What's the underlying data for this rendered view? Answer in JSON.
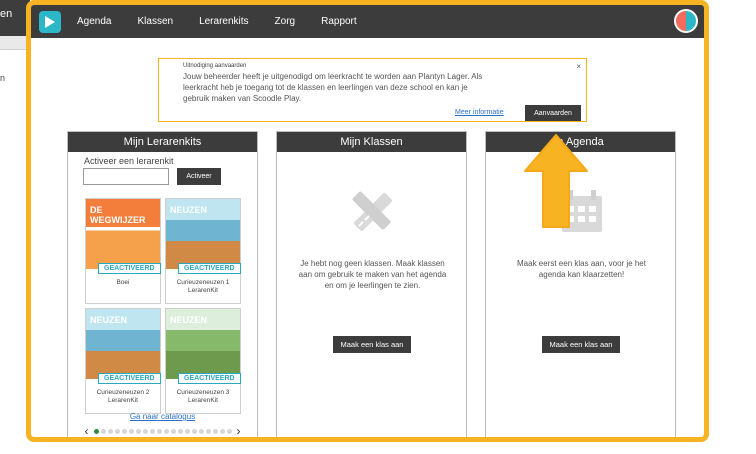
{
  "background": {
    "nav_fragment": "en",
    "sub_fragment": "n"
  },
  "nav": {
    "items": [
      "Agenda",
      "Klassen",
      "Lerarenkits",
      "Zorg",
      "Rapport"
    ]
  },
  "invite": {
    "title": "Uitnodiging aanvaarden",
    "text": "Jouw beheerder heeft je uitgenodigd om leerkracht te worden aan Plantyn Lager. Als leerkracht heb je toegang tot de klassen en leerlingen van deze school en kan je gebruik maken van Scoodle Play.",
    "close": "×",
    "more_info": "Meer informatie",
    "accept": "Aanvaarden"
  },
  "kits_panel": {
    "title": "Mijn Lerarenkits",
    "activate_label": "Activeer een lerarenkit",
    "activate_input_value": "",
    "activate_button": "Activeer",
    "kits": [
      {
        "name": "Boei",
        "badge": "GEACTIVEERD",
        "cover_word": "DE WEGWIJZER",
        "cover": "orange"
      },
      {
        "name": "Curieuzeneuzen 1 LerarenKit",
        "badge": "GEACTIVEERD",
        "cover_word": "NEUZEN",
        "cover": "blue"
      },
      {
        "name": "Curieuzeneuzen 2 LerarenKit",
        "badge": "GEACTIVEERD",
        "cover_word": "NEUZEN",
        "cover": "blue"
      },
      {
        "name": "Curieuzeneuzen 3 LerarenKit",
        "badge": "GEACTIVEERD",
        "cover_word": "NEUZEN",
        "cover": "green"
      }
    ],
    "catalog_link": "Ga naar catalogus",
    "pager_prev": "‹",
    "pager_next": "›",
    "pager_page": 1,
    "pager_total": 20
  },
  "classes_panel": {
    "title": "Mijn Klassen",
    "text": "Je hebt nog geen klassen. Maak klassen aan om gebruik te maken van het agenda en om je leerlingen te zien.",
    "button": "Maak een klas aan"
  },
  "agenda_panel": {
    "title": "Mijn Agenda",
    "title_visible": "n Agenda",
    "text": "Maak eerst een klas aan, voor je het agenda kan klaarzetten!",
    "button": "Maak een klas aan"
  },
  "colors": {
    "highlight": "#f7b321",
    "topbar": "#3c3c3c",
    "brand": "#2cb7c9",
    "link": "#2a6fc9",
    "active_dot": "#2e8b3e"
  }
}
